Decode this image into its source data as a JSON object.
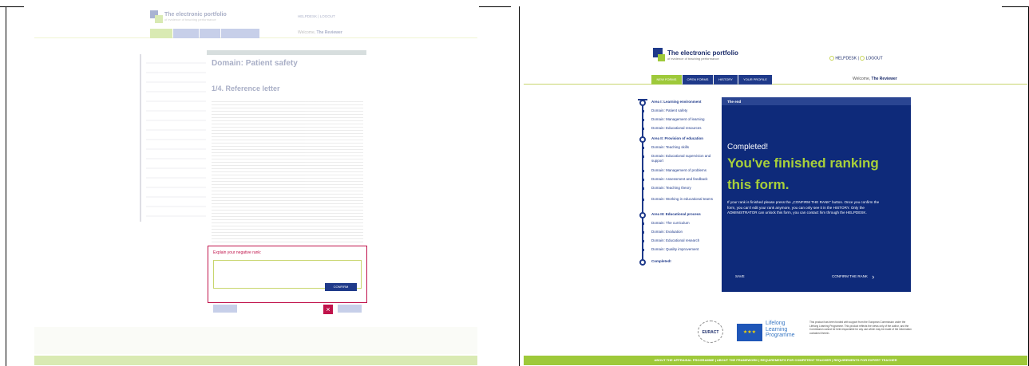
{
  "left_panel": {
    "brand": {
      "title": "The electronic portfolio",
      "subtitle": "of evidence of teaching performance"
    },
    "header_links": {
      "helpdesk": "HELPDESK",
      "separator": "|",
      "logout": "LOGOUT"
    },
    "welcome": {
      "prefix": "Welcome,",
      "user": "The Reviewer"
    },
    "domain_title": "Domain: Patient safety",
    "section_title": "1/4. Reference letter",
    "explain_label": "Explain your negative rank:",
    "confirm_button": "CONFIRM"
  },
  "right_panel": {
    "brand": {
      "title": "The electronic portfolio",
      "subtitle": "of evidence of teaching performance"
    },
    "header_links": {
      "helpdesk": "HELPDESK",
      "separator": "|",
      "logout": "LOGOUT"
    },
    "tabs": [
      "NEW FORMS",
      "OPEN FORMS",
      "HISTORY",
      "YOUR PROFILE"
    ],
    "welcome": {
      "prefix": "Welcome,",
      "user": "The Reviewer"
    },
    "timeline": [
      {
        "label": "Area I: Learning environment",
        "bold": true
      },
      {
        "label": "Domain: Patient safety"
      },
      {
        "label": "Domain: Management of learning"
      },
      {
        "label": "Domain: Educational resources"
      },
      {
        "label": "Area II: Provision of education",
        "bold": true
      },
      {
        "label": "Domain: Teaching skills"
      },
      {
        "label": "Domain: Educational supervision and support"
      },
      {
        "label": "Domain: Management of problems"
      },
      {
        "label": "Domain: Assessment and feedback"
      },
      {
        "label": "Domain: Teaching theory"
      },
      {
        "label": "Domain: Working in educational teams"
      },
      {
        "label": "Area III: Educational process",
        "bold": true
      },
      {
        "label": "Domain: The curriculum"
      },
      {
        "label": "Domain: Evaluation"
      },
      {
        "label": "Domain: Educational research"
      },
      {
        "label": "Domain: Quality improvement"
      },
      {
        "label": "Completed!",
        "bold": true
      }
    ],
    "box": {
      "header": "The end",
      "completed": "Completed!",
      "headline1": "You've finished ranking",
      "headline2": "this form.",
      "body": "If your rank is finished please press the „CONFIRM THE RANK“ button. Once you confirm the form, you can't edit your rank anymore, you can only see it in the HISTORY. Only the ADMINISTRATOR can unlock this form, you can contact him through the HELPDESK.",
      "save": "SAVE",
      "confirm": "CONFIRM THE RANK",
      "confirm_icon": "chevron-right-icon"
    },
    "footer": {
      "euract": "EURACT",
      "lll1": "Lifelong",
      "lll2": "Learning",
      "lll3": "Programme",
      "disclaimer": "This product has been funded with support from the European Commission under the Lifelong Learning Programme. This product reflects the views only of the author, and the Commission cannot be held responsible for any use which may be made of the information contained therein.",
      "links": "ABOUT THE APPRAISAL PROGRAMME  |  ABOUT THE FRAMEWORK  |  REQUIREMENTS FOR COMPETENT TEACHER  |  REQUIREMENTS FOR EXPERT TEACHER"
    }
  },
  "colors": {
    "navy": "#0e2a7a",
    "green": "#9ec93a",
    "headline": "#a8d03a",
    "crimson": "#c0134b"
  }
}
